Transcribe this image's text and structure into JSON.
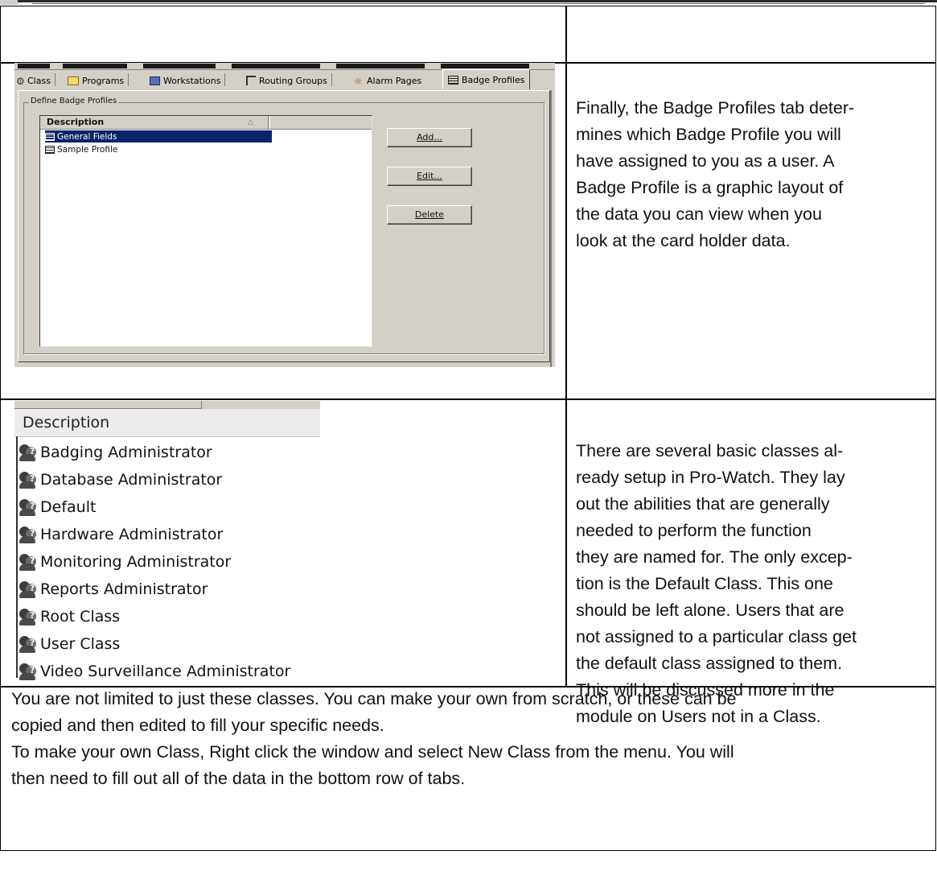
{
  "dialog": {
    "tabs": [
      {
        "label": "Class",
        "icon": "class-icon"
      },
      {
        "label": "Programs",
        "icon": "folder-icon"
      },
      {
        "label": "Workstations",
        "icon": "workstation-icon"
      },
      {
        "label": "Routing Groups",
        "icon": "routing-icon"
      },
      {
        "label": "Alarm Pages",
        "icon": "alarm-icon"
      },
      {
        "label": "Badge Profiles",
        "icon": "badge-icon",
        "active": true
      }
    ],
    "group_title": "Define Badge Profiles",
    "list_header": "Description",
    "list_items": [
      {
        "label": "General Fields",
        "selected": true
      },
      {
        "label": "Sample Profile",
        "selected": false
      }
    ],
    "buttons": {
      "add": "Add...",
      "edit": "Edit...",
      "delete": "Delete"
    }
  },
  "class_list": {
    "header": "Description",
    "items": [
      "Badging Administrator",
      "Database Administrator",
      "Default",
      "Hardware Administrator",
      "Monitoring Administrator",
      "Reports Administrator",
      "Root Class",
      "User Class",
      "Video Surveillance Administrator"
    ]
  },
  "text": {
    "badge_profiles": [
      "Finally, the Badge Profiles tab deter-",
      "mines which Badge Profile you will",
      "have assigned to you as a user. A",
      "Badge Profile is a graphic layout of",
      "the data you can view when you",
      "look at the card holder data."
    ],
    "classes": [
      "There are several basic classes al-",
      "ready setup in Pro-Watch. They lay",
      "out the abilities that are generally",
      "needed to perform the function",
      "they are named for. The only excep-",
      "tion is the Default Class. This one",
      "should be left alone. Users that are",
      "not assigned to a particular class get",
      "the default class assigned to them.",
      "This will be discussed more in the",
      "module on Users not in a Class."
    ],
    "bottom": [
      "You are not limited to just these classes. You can make your own from scratch, or these can be",
      "copied and then edited to fill your specific needs.",
      "To make your own Class, Right click the window and select New Class from the menu. You will",
      "then need to fill out all of the data in the bottom row of tabs."
    ]
  }
}
